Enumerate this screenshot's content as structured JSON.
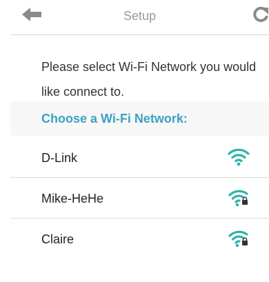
{
  "header": {
    "title": "Setup",
    "back_icon": "arrow-left-icon",
    "refresh_icon": "refresh-icon"
  },
  "instructions": {
    "text": "Please select Wi-Fi Network you would like connect to.",
    "choose_label": "Choose a  Wi-Fi  Network:"
  },
  "networks": [
    {
      "name": "D-Link",
      "secured": false
    },
    {
      "name": "Mike-HeHe",
      "secured": true
    },
    {
      "name": "Claire",
      "secured": true
    }
  ],
  "colors": {
    "accent": "#3aa2c2",
    "icon_gray": "#808080",
    "wifi_green": "#2bb3a7"
  }
}
